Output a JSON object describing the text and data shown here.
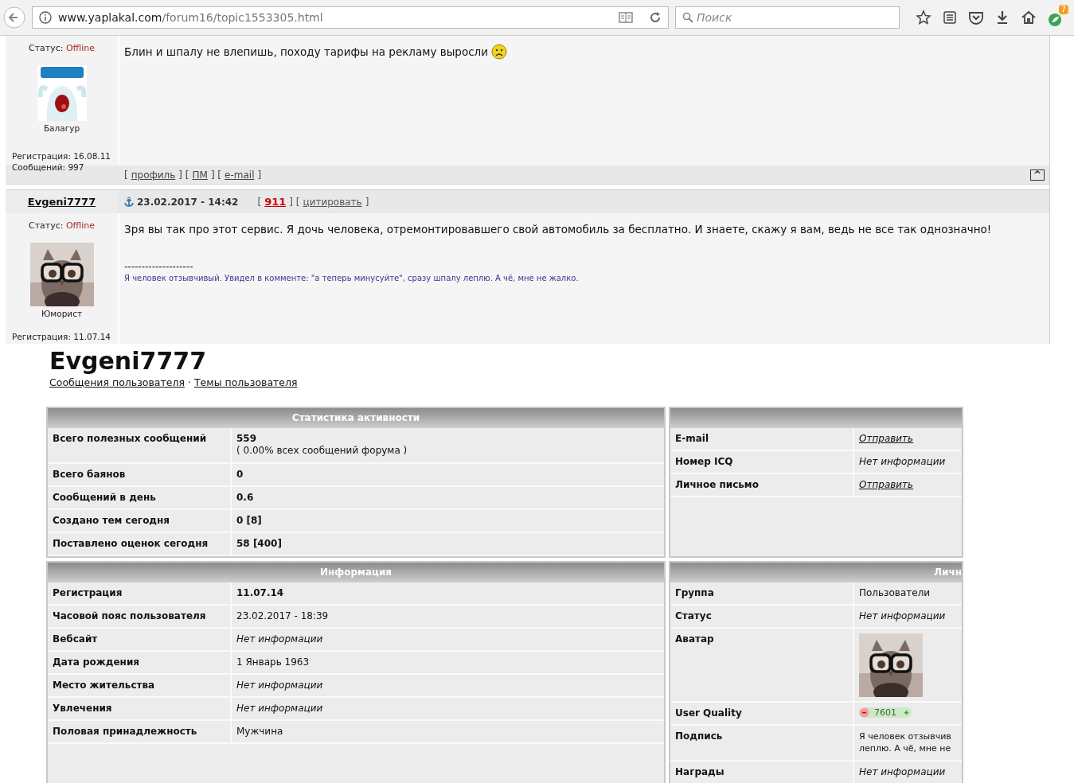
{
  "browser": {
    "url_host": "www.yaplakal.com",
    "url_path": "/forum16/topic1553305.html",
    "search_placeholder": "Поиск",
    "badge": "7"
  },
  "posts": [
    {
      "status_label": "Статус:",
      "status": "Offline",
      "rank": "Балагур",
      "registration": "Регистрация: 16.08.11",
      "messages": "Сообщений: 997",
      "text": "Блин и шпалу не влепишь, походу тарифы на рекламу выросли",
      "smiley": true,
      "footer": [
        {
          "kind": "text",
          "text": "["
        },
        {
          "kind": "link",
          "text": "профиль"
        },
        {
          "kind": "text",
          "text": "] ["
        },
        {
          "kind": "link",
          "text": "ПМ"
        },
        {
          "kind": "text",
          "text": "] ["
        },
        {
          "kind": "link",
          "text": "e-mail"
        },
        {
          "kind": "text",
          "text": "]"
        }
      ],
      "top_link": "^"
    },
    {
      "author": "Evgeni7777",
      "date": "23.02.2017 - 14:42",
      "header": [
        {
          "kind": "text",
          "text": "["
        },
        {
          "kind": "rating",
          "text": "911"
        },
        {
          "kind": "text",
          "text": "] ["
        },
        {
          "kind": "link",
          "text": "цитировать"
        },
        {
          "kind": "text",
          "text": "]"
        }
      ],
      "status_label": "Статус:",
      "status": "Offline",
      "rank": "Юморист",
      "registration": "Регистрация: 11.07.14",
      "text": "Зря вы так про этот сервис. Я дочь человека, отремонтировавшего свой автомобиль за бесплатно. И знаете, скажу я вам, ведь не все так однозначно!",
      "separator": "--------------------",
      "signature": "Я человек отзывчивый. Увидел в комменте: \"а теперь минусуйте\", сразу шпалу леплю. А чё, мне не жалко."
    }
  ],
  "profile": {
    "name": "Evgeni7777",
    "links": [
      "Сообщения пользователя",
      "Темы пользователя"
    ],
    "link_separator": "·",
    "left_tables": [
      {
        "title": "Статистика активности",
        "rows": [
          {
            "label": "Всего полезных сообщений",
            "kind": "bold",
            "value": "559",
            "note": "( 0.00% всех сообщений форума )"
          },
          {
            "label": "Всего баянов",
            "kind": "bold",
            "value": "0"
          },
          {
            "label": "Сообщений в день",
            "kind": "bold",
            "value": "0.6"
          },
          {
            "label": "Создано тем сегодня",
            "kind": "bold",
            "value": "0 [8]"
          },
          {
            "label": "Поставлено оценок сегодня",
            "kind": "bold",
            "value": "58 [400]"
          }
        ]
      },
      {
        "title": "Информация",
        "rows": [
          {
            "label": "Регистрация",
            "kind": "bold",
            "value": "11.07.14"
          },
          {
            "label": "Часовой пояс пользователя",
            "kind": "plain",
            "value": "23.02.2017 - 18:39"
          },
          {
            "label": "Вебсайт",
            "kind": "italic",
            "value": "Нет информации"
          },
          {
            "label": "Дата рождения",
            "kind": "plain",
            "value": "1 Январь 1963"
          },
          {
            "label": "Место жительства",
            "kind": "italic",
            "value": "Нет информации"
          },
          {
            "label": "Увлечения",
            "kind": "italic",
            "value": "Нет информации"
          },
          {
            "label": "Половая принадлежность",
            "kind": "plain",
            "value": "Мужчина"
          }
        ]
      }
    ],
    "right_tables": [
      {
        "rows": [
          {
            "label": "E-mail",
            "kind": "link",
            "value": "Отправить"
          },
          {
            "label": "Номер ICQ",
            "kind": "italic",
            "value": "Нет информации"
          },
          {
            "label": "Личное письмо",
            "kind": "link",
            "value": "Отправить"
          }
        ]
      },
      {
        "title": "Личн",
        "rows": [
          {
            "label": "Группа",
            "kind": "plain",
            "value": "Пользователи"
          },
          {
            "label": "Статус",
            "kind": "italic",
            "value": "Нет информации"
          },
          {
            "label": "Аватар",
            "kind": "picture"
          },
          {
            "label": "User Quality",
            "kind": "rating",
            "value": "7601"
          },
          {
            "label": "Подпись",
            "kind": "lines",
            "lines": [
              "Я человек отзывчив",
              "леплю. А чё, мне не"
            ]
          },
          {
            "label": "Награды",
            "kind": "italic",
            "value": "Нет информации"
          }
        ]
      }
    ]
  }
}
